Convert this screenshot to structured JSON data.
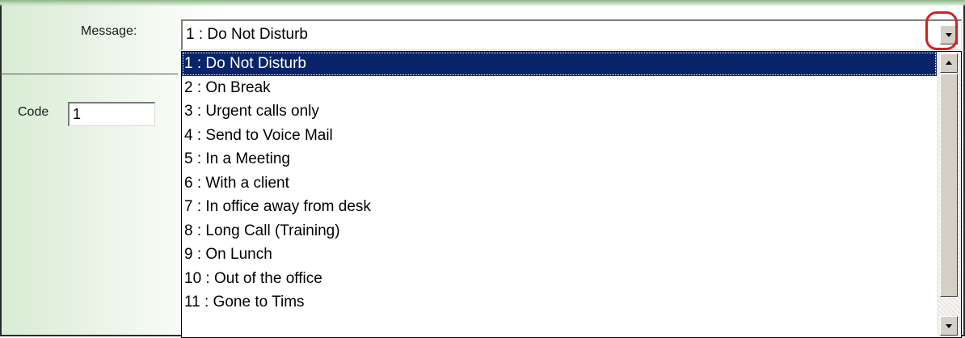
{
  "form": {
    "message_label": "Message:",
    "code_label": "Code",
    "code_value": "1"
  },
  "message_select": {
    "selected_value": "1 : Do Not Disturb",
    "open": true,
    "options": [
      {
        "label": "1 : Do Not Disturb",
        "selected": true
      },
      {
        "label": "2 : On Break",
        "selected": false
      },
      {
        "label": "3 : Urgent calls only",
        "selected": false
      },
      {
        "label": "4 : Send to Voice Mail",
        "selected": false
      },
      {
        "label": "5 : In a Meeting",
        "selected": false
      },
      {
        "label": "6 : With a client",
        "selected": false
      },
      {
        "label": "7 : In office away from desk",
        "selected": false
      },
      {
        "label": "8 : Long Call (Training)",
        "selected": false
      },
      {
        "label": "9 : On Lunch",
        "selected": false
      },
      {
        "label": "10 : Out of the office",
        "selected": false
      },
      {
        "label": "11 : Gone to Tims",
        "selected": false
      }
    ]
  },
  "colors": {
    "selection_bg": "#0a246a",
    "selection_fg": "#ffffff",
    "highlight_ring": "#d42020",
    "panel_gradient": "#d9ecd4"
  },
  "icons": {
    "dropdown_button": "chevron-down-icon",
    "scroll_up": "chevron-up-icon",
    "scroll_down": "chevron-down-icon"
  }
}
